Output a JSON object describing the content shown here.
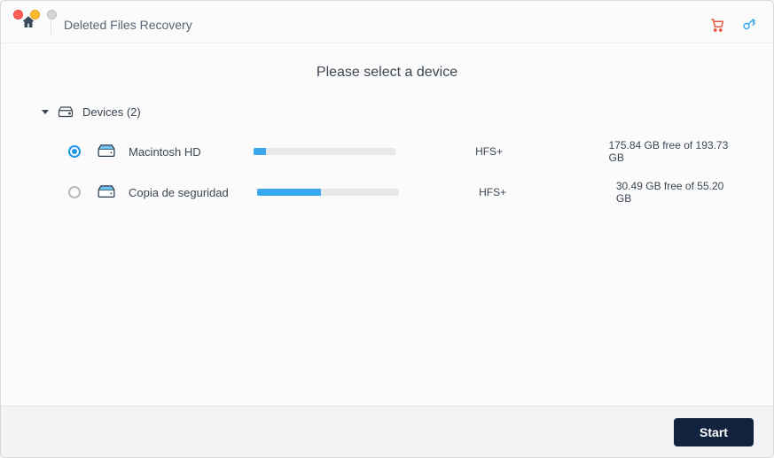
{
  "header": {
    "title": "Deleted Files Recovery"
  },
  "main": {
    "heading": "Please select a device",
    "group_label": "Devices (2)"
  },
  "devices": [
    {
      "name": "Macintosh HD",
      "filesystem": "HFS+",
      "free_text": "175.84 GB free of 193.73 GB",
      "used_pct": 9,
      "selected": true
    },
    {
      "name": "Copia de seguridad",
      "filesystem": "HFS+",
      "free_text": "30.49 GB free of 55.20 GB",
      "used_pct": 45,
      "selected": false
    }
  ],
  "footer": {
    "start_label": "Start"
  },
  "icons": {
    "home": "home-icon",
    "cart": "cart-icon",
    "key": "key-icon",
    "drive": "drive-icon",
    "chevron": "chevron-down-icon"
  },
  "colors": {
    "accent": "#1f97e6",
    "footer_btn": "#12233f",
    "cart": "#e8583f",
    "key": "#3aa9e8"
  }
}
